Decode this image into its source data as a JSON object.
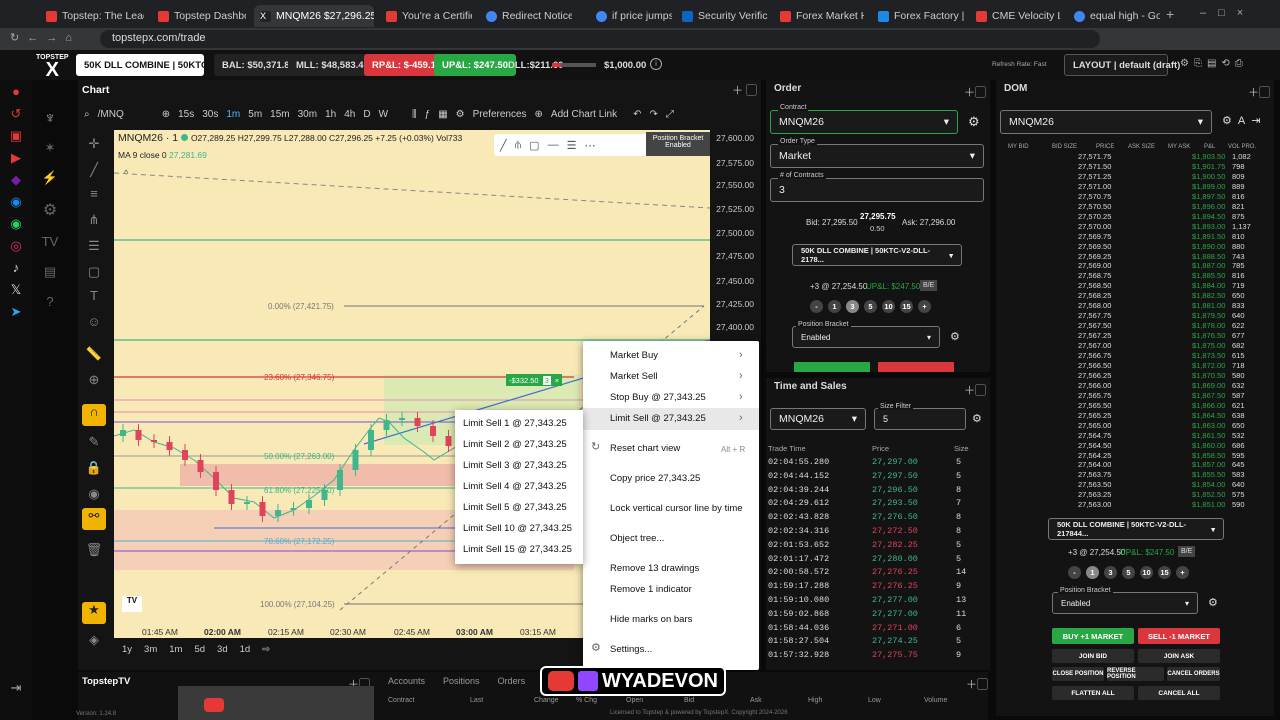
{
  "browser": {
    "tabs": [
      {
        "label": "Topstep: The Lead",
        "color": "#e53935"
      },
      {
        "label": "Topstep Dashboar",
        "color": "#e53935"
      },
      {
        "label": "MNQM26 $27,296.25 ▼",
        "color": "#e53935"
      },
      {
        "label": "You're a Certified",
        "color": "#e53935"
      },
      {
        "label": "Redirect Notice",
        "color": "#4285f4"
      },
      {
        "label": "if price jumps up c",
        "color": "#4285f4"
      },
      {
        "label": "Security Verificati",
        "color": "#0a66c2"
      },
      {
        "label": "Forex Market Hou",
        "color": "#e53935"
      },
      {
        "label": "Forex Factory | Gl",
        "color": "#1e88e5"
      },
      {
        "label": "CME Velocity Log",
        "color": "#e53935"
      },
      {
        "label": "equal high - Goog",
        "color": "#4285f4"
      }
    ],
    "url": "topstepx.com/trade"
  },
  "topbar": {
    "account": "50K DLL COMBINE  |  50KTC-...",
    "bal": "BAL: $50,371.80",
    "mll": "MLL: $48,583.40",
    "rpl": "RP&L: $-459.10",
    "upl": "UP&L: $247.50",
    "dll": "DLL:$211.60",
    "dll_max": "$1,000.00",
    "refresh": "Refresh Rate: Fast",
    "layout": "LAYOUT  |  default (draft)"
  },
  "chart": {
    "panel_title": "Chart",
    "symbol": "/MNQ",
    "timeframes": [
      "15s",
      "30s",
      "1m",
      "5m",
      "15m",
      "30m",
      "1h",
      "4h",
      "D",
      "W"
    ],
    "preferences": "Preferences",
    "add_link": "Add Chart Link",
    "ohlc_title": "MNQM26 · 1",
    "ohlc": "O27,289.25  H27,299.75  L27,288.00  C27,296.25  +7.25 (+0.03%)  Vol733",
    "ma_label": "MA 9 close 0",
    "ma_value": "27,281.69",
    "y_ticks": [
      "27,600.00",
      "27,575.00",
      "27,550.00",
      "27,525.00",
      "27,500.00",
      "27,475.00",
      "27,450.00",
      "27,425.00",
      "27,400.00"
    ],
    "x_ticks": [
      "01:45 AM",
      "02:00 AM",
      "02:15 AM",
      "02:30 AM",
      "02:45 AM",
      "03:00 AM",
      "03:15 AM"
    ],
    "fib": [
      "0.00% (27,421.75)",
      "23.60% (27,346.75)",
      "50.00% (27,263.00)",
      "61.80% (27,225.50)",
      "78.60% (27,172.25)",
      "100.00% (27,104.25)"
    ],
    "position_tag": "-$332.50",
    "position_qty": "3",
    "bracket_label": "Position Bracket",
    "bracket_state": "Enabled",
    "ranges": [
      "1y",
      "3m",
      "1m",
      "5d",
      "3d",
      "1d"
    ]
  },
  "context_menu": {
    "items": [
      "Market Buy",
      "Market Sell",
      "Stop Buy @ 27,343.25",
      "Limit Sell @ 27,343.25",
      "Reset chart view",
      "Copy price 27,343.25",
      "Lock vertical cursor line by time",
      "Object tree...",
      "Remove 13 drawings",
      "Remove 1 indicator",
      "Hide marks on bars",
      "Settings..."
    ],
    "reset_shortcut": "Alt + R"
  },
  "submenu": {
    "items": [
      "Limit Sell 1 @ 27,343.25",
      "Limit Sell 2 @ 27,343.25",
      "Limit Sell 3 @ 27,343.25",
      "Limit Sell 4 @ 27,343.25",
      "Limit Sell 5 @ 27,343.25",
      "Limit Sell 10 @ 27,343.25",
      "Limit Sell 15 @ 27,343.25"
    ]
  },
  "order": {
    "title": "Order",
    "contract_label": "Contract",
    "contract": "MNQM26",
    "type_label": "Order Type",
    "type": "Market",
    "qty_label": "# of Contracts",
    "qty": "3",
    "bid": "Bid: 27,295.50",
    "last": "27,295.75",
    "spread": "0.50",
    "ask": "Ask: 27,296.00",
    "account": "50K DLL COMBINE  |  50KTC-V2-DLL-2178...",
    "pos": "+3 @ 27,254.50",
    "upl": "UP&L: $247.50",
    "be": "B/E",
    "qtys": [
      "-",
      "1",
      "3",
      "5",
      "10",
      "15",
      "+"
    ],
    "bracket_label": "Position Bracket",
    "bracket": "Enabled"
  },
  "time_sales": {
    "title": "Time and Sales",
    "contract": "MNQM26",
    "size_label": "Size Filter",
    "size": "5",
    "headers": [
      "Trade Time",
      "Price",
      "Size"
    ],
    "rows": [
      [
        "02:04:55.280",
        "27,297.00",
        "5",
        "g"
      ],
      [
        "02:04:44.152",
        "27,297.50",
        "5",
        "g"
      ],
      [
        "02:04:39.244",
        "27,296.50",
        "8",
        "g"
      ],
      [
        "02:04:29.612",
        "27,293.50",
        "7",
        "g"
      ],
      [
        "02:02:43.828",
        "27,276.50",
        "8",
        "g"
      ],
      [
        "02:02:34.316",
        "27,272.50",
        "8",
        "r"
      ],
      [
        "02:01:53.652",
        "27,282.25",
        "5",
        "r"
      ],
      [
        "02:01:17.472",
        "27,280.00",
        "5",
        "g"
      ],
      [
        "02:00:58.572",
        "27,276.25",
        "14",
        "r"
      ],
      [
        "01:59:17.288",
        "27,276.25",
        "9",
        "r"
      ],
      [
        "01:59:10.080",
        "27,277.00",
        "13",
        "g"
      ],
      [
        "01:59:02.868",
        "27,277.00",
        "11",
        "g"
      ],
      [
        "01:58:44.036",
        "27,271.00",
        "6",
        "r"
      ],
      [
        "01:58:27.504",
        "27,274.25",
        "5",
        "g"
      ],
      [
        "01:57:32.928",
        "27,275.75",
        "9",
        "r"
      ]
    ]
  },
  "dom": {
    "title": "DOM",
    "contract": "MNQM26",
    "headers": [
      "MY BID",
      "BID SIZE",
      "PRICE",
      "ASK SIZE",
      "MY ASK",
      "P&L",
      "VOL PRO."
    ],
    "rows": [
      [
        "27,571.75",
        "$1,903.50",
        "1,082"
      ],
      [
        "27,571.50",
        "$1,901.75",
        "798"
      ],
      [
        "27,571.25",
        "$1,900.50",
        "809"
      ],
      [
        "27,571.00",
        "$1,899.00",
        "889"
      ],
      [
        "27,570.75",
        "$1,897.50",
        "816"
      ],
      [
        "27,570.50",
        "$1,896.00",
        "821"
      ],
      [
        "27,570.25",
        "$1,894.50",
        "875"
      ],
      [
        "27,570.00",
        "$1,893.00",
        "1,137"
      ],
      [
        "27,569.75",
        "$1,891.50",
        "810"
      ],
      [
        "27,569.50",
        "$1,890.00",
        "880"
      ],
      [
        "27,569.25",
        "$1,888.50",
        "743"
      ],
      [
        "27,569.00",
        "$1,887.00",
        "785"
      ],
      [
        "27,568.75",
        "$1,885.50",
        "816"
      ],
      [
        "27,568.50",
        "$1,884.00",
        "719"
      ],
      [
        "27,568.25",
        "$1,882.50",
        "650"
      ],
      [
        "27,568.00",
        "$1,881.00",
        "833"
      ],
      [
        "27,567.75",
        "$1,879.50",
        "640"
      ],
      [
        "27,567.50",
        "$1,878.00",
        "622"
      ],
      [
        "27,567.25",
        "$1,876.50",
        "677"
      ],
      [
        "27,567.00",
        "$1,875.00",
        "682"
      ],
      [
        "27,566.75",
        "$1,873.50",
        "615"
      ],
      [
        "27,566.50",
        "$1,872.00",
        "718"
      ],
      [
        "27,566.25",
        "$1,870.50",
        "580"
      ],
      [
        "27,566.00",
        "$1,869.00",
        "632"
      ],
      [
        "27,565.75",
        "$1,867.50",
        "587"
      ],
      [
        "27,565.50",
        "$1,866.00",
        "621"
      ],
      [
        "27,565.25",
        "$1,864.50",
        "638"
      ],
      [
        "27,565.00",
        "$1,863.00",
        "650"
      ],
      [
        "27,564.75",
        "$1,861.50",
        "532"
      ],
      [
        "27,564.50",
        "$1,860.00",
        "686"
      ],
      [
        "27,564.25",
        "$1,858.50",
        "595"
      ],
      [
        "27,564.00",
        "$1,857.00",
        "645"
      ],
      [
        "27,563.75",
        "$1,855.50",
        "583"
      ],
      [
        "27,563.50",
        "$1,854.00",
        "640"
      ],
      [
        "27,563.25",
        "$1,852.50",
        "575"
      ],
      [
        "27,563.00",
        "$1,851.00",
        "590"
      ]
    ],
    "account": "50K DLL COMBINE  |  50KTC-V2-DLL-217844...",
    "pos": "+3 @ 27,254.50",
    "upl": "UP&L: $247.50",
    "be": "B/E",
    "qtys": [
      "-",
      "1",
      "3",
      "5",
      "10",
      "15",
      "+"
    ],
    "bracket_label": "Position Bracket",
    "bracket": "Enabled",
    "buy": "BUY +1 MARKET",
    "sell": "SELL -1 MARKET",
    "buttons": [
      "JOIN BID",
      "JOIN ASK",
      "CLOSE POSITION",
      "REVERSE POSITION",
      "CANCEL ORDERS",
      "FLATTEN ALL",
      "CANCEL ALL"
    ]
  },
  "bottom": {
    "tv_title": "TopstepTV",
    "tabs": [
      "Accounts",
      "Positions",
      "Orders"
    ],
    "headers": [
      "Contract",
      "Last",
      "Change",
      "% Chg",
      "Open",
      "Bid",
      "Ask",
      "High",
      "Low",
      "Volume"
    ],
    "watermark": "WYADEVON",
    "license": "Licensed to Topstep & powered by TopstepX. Copyright 2024-2026",
    "version": "Version: 1.24.8"
  },
  "colors": {
    "green": "#28a745",
    "red": "#d9363e",
    "accent": "#e53935"
  }
}
